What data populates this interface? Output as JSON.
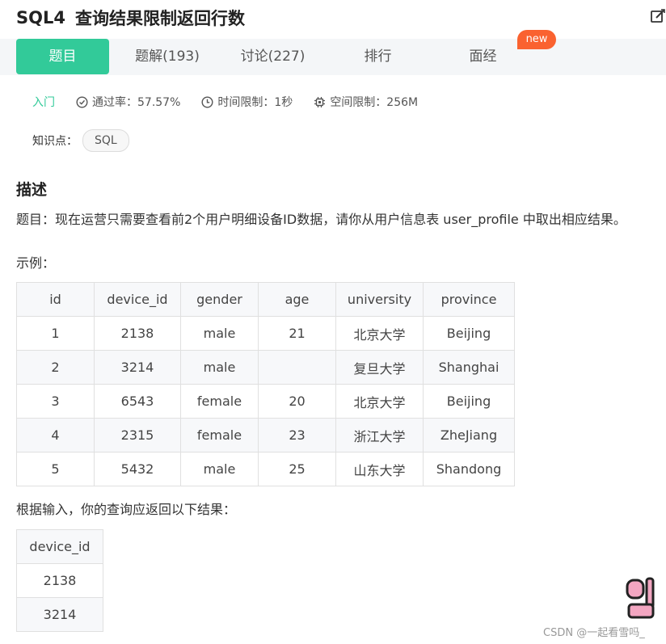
{
  "header": {
    "question_id": "SQL4",
    "title": "查询结果限制返回行数"
  },
  "tabs": [
    {
      "label": "题目",
      "active": true
    },
    {
      "label": "题解(193)",
      "active": false
    },
    {
      "label": "讨论(227)",
      "active": false
    },
    {
      "label": "排行",
      "active": false
    },
    {
      "label": "面经",
      "active": false
    }
  ],
  "badge_new": "new",
  "meta": {
    "level": "入门",
    "pass_rate": "通过率：57.57%",
    "time_limit": "时间限制：1秒",
    "space_limit": "空间限制：256M"
  },
  "knowledge": {
    "label": "知识点：",
    "tag": "SQL"
  },
  "description": {
    "heading": "描述",
    "text": "题目：现在运营只需要查看前2个用户明细设备ID数据，请你从用户信息表 user_profile 中取出相应结果。",
    "example_label": "示例：",
    "result_label": "根据输入，你的查询应返回以下结果："
  },
  "example_table": {
    "columns": [
      "id",
      "device_id",
      "gender",
      "age",
      "university",
      "province"
    ],
    "rows": [
      [
        "1",
        "2138",
        "male",
        "21",
        "北京大学",
        "Beijing"
      ],
      [
        "2",
        "3214",
        "male",
        "",
        "复旦大学",
        "Shanghai"
      ],
      [
        "3",
        "6543",
        "female",
        "20",
        "北京大学",
        "Beijing"
      ],
      [
        "4",
        "2315",
        "female",
        "23",
        "浙江大学",
        "ZheJiang"
      ],
      [
        "5",
        "5432",
        "male",
        "25",
        "山东大学",
        "Shandong"
      ]
    ]
  },
  "result_table": {
    "columns": [
      "device_id"
    ],
    "rows": [
      [
        "2138"
      ],
      [
        "3214"
      ]
    ]
  },
  "watermark": "CSDN @一起看雪吗_",
  "colors": {
    "accent": "#32ca99",
    "badge": "#fa6230"
  },
  "icons": {
    "edit": "edit-icon",
    "pass_rate": "check-circle-icon",
    "time_limit": "clock-icon",
    "space_limit": "chip-icon"
  }
}
